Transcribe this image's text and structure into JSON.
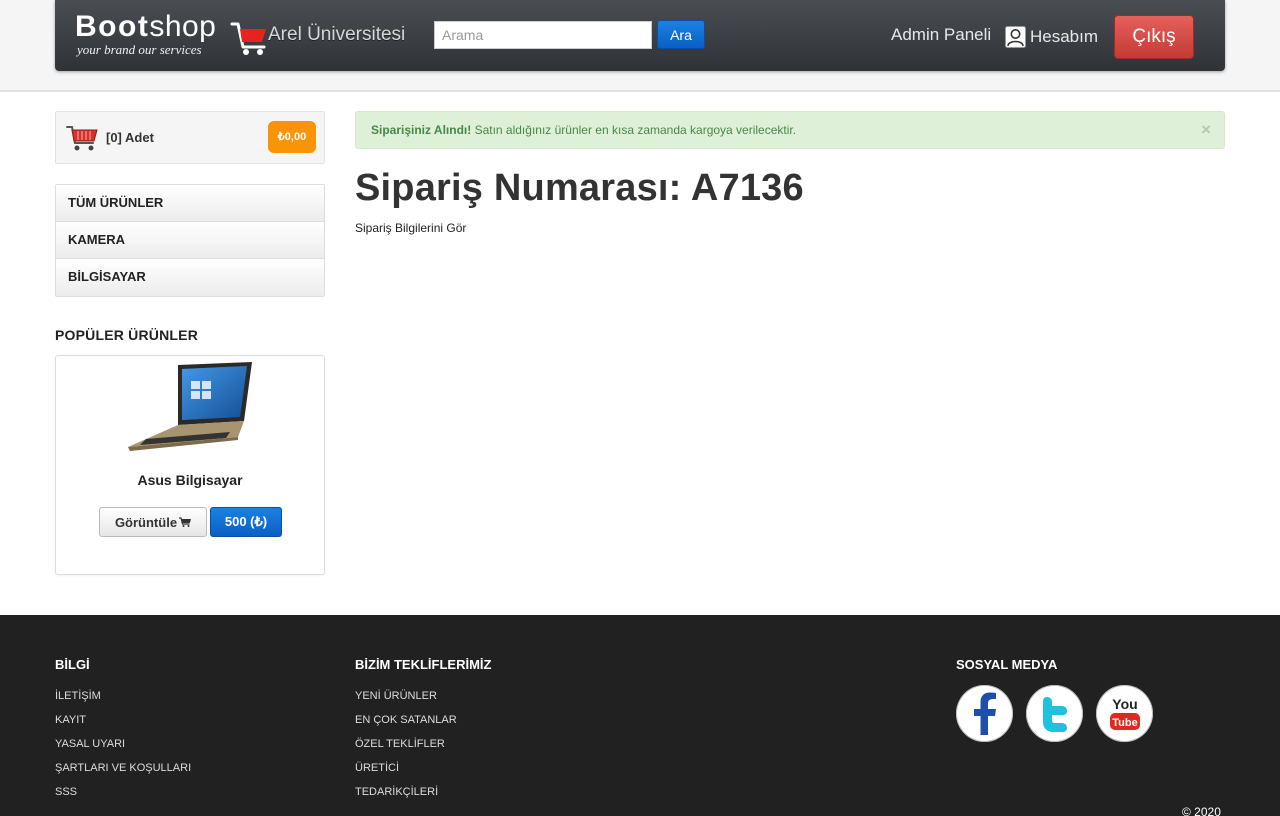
{
  "header": {
    "brand_bold": "Boot",
    "brand_light": "shop",
    "tagline": "your brand our services",
    "site_name": "Arel Üniversitesi",
    "search_placeholder": "Arama",
    "search_button": "Ara",
    "admin_link": "Admin Paneli",
    "account_link": "Hesabım",
    "logout_button": "Çıkış"
  },
  "sidebar": {
    "cart_count": "[0] Adet",
    "cart_total": "₺0,00",
    "categories": [
      "TÜM ÜRÜNLER",
      "KAMERA",
      "BİLGİSAYAR"
    ],
    "popular_title": "POPÜLER ÜRÜNLER",
    "product": {
      "name": "Asus Bilgisayar",
      "view_button": "Görüntüle",
      "price_button": "500 (₺)"
    }
  },
  "main": {
    "alert_strong": "Siparişiniz Alındı!",
    "alert_text": " Satın aldığınız ürünler en kısa zamanda kargoya verilecektir.",
    "alert_close": "×",
    "order_heading": "Sipariş Numarası: A7136",
    "order_link": "Sipariş Bilgilerini Gör"
  },
  "footer": {
    "info_title": "BİLGİ",
    "info_links": [
      "İLETİŞİM",
      "KAYIT",
      "YASAL UYARI",
      "ŞARTLARI VE KOŞULLARI",
      "SSS"
    ],
    "offers_title": "BİZİM TEKLİFLERİMİZ",
    "offers_links": [
      "YENİ ÜRÜNLER",
      "EN ÇOK SATANLAR",
      "ÖZEL TEKLİFLER",
      "ÜRETİCİ",
      "TEDARİKÇİLERİ"
    ],
    "social_title": "SOSYAL MEDYA",
    "copyright": "© 2020"
  }
}
